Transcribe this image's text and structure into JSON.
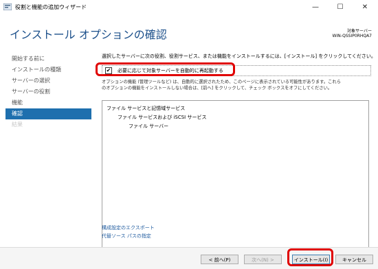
{
  "window": {
    "title": "役割と機能の追加ウィザード",
    "minimize": "—",
    "maximize": "☐",
    "close": "✕"
  },
  "header": {
    "title": "インストール オプションの確認",
    "target_label": "対象サーバー",
    "target_server": "WIN-QSSIP0RHQA7"
  },
  "nav": {
    "items": [
      {
        "label": "開始する前に"
      },
      {
        "label": "インストールの種類"
      },
      {
        "label": "サーバーの選択"
      },
      {
        "label": "サーバーの役割"
      },
      {
        "label": "機能"
      },
      {
        "label": "確認"
      },
      {
        "label": "結果"
      }
    ]
  },
  "main": {
    "intro": "選択したサーバーに次の役割、役割サービス、または機能をインストールするには、[インストール] をクリックしてください。",
    "restart_checkbox": "必要に応じて対象サーバーを自動的に再起動する",
    "checkbox_mark": "✔",
    "desc_line1": "オプションの機能 (管理ツールなど) は、自動的に選択されたため、このページに表示されている可能性があります。これら",
    "desc_line2": "のオプションの機能をインストールしない場合は、[前へ] をクリックして、チェック ボックスをオフにしてください。",
    "features": [
      "ファイル サービスと記憶域サービス",
      "ファイル サービスおよび iSCSI サービス",
      "ファイル サーバー"
    ],
    "export_link": "構成設定のエクスポート",
    "alt_source_link": "代替ソース パスの指定"
  },
  "footer": {
    "prev": "< 前へ(P)",
    "next": "次へ(N) >",
    "install": "インストール(I)",
    "cancel": "キャンセル"
  },
  "colors": {
    "accent": "#1e6fae",
    "title": "#1b4f8a",
    "highlight": "#e00000",
    "link": "#1e5a9e"
  }
}
